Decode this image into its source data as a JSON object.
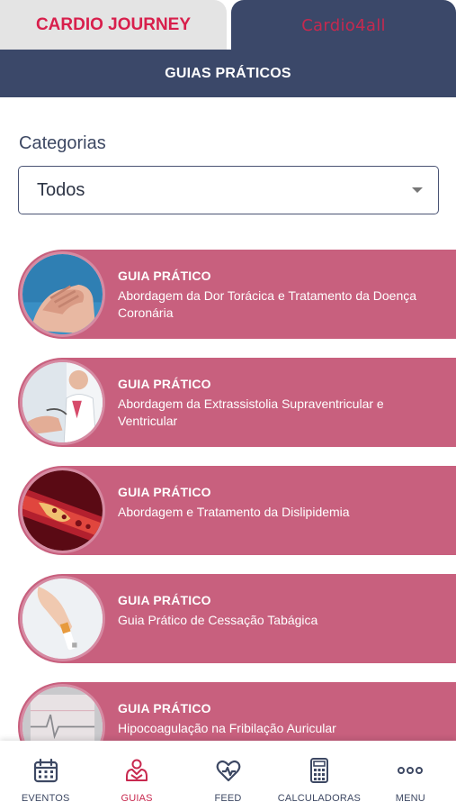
{
  "top_tabs": {
    "left": "CARDIO JOURNEY",
    "right": "Cardio4all"
  },
  "header": {
    "title": "GUIAS PRÁTICOS"
  },
  "categories": {
    "label": "Categorias",
    "selected": "Todos"
  },
  "guides": [
    {
      "kicker": "GUIA PRÁTICO",
      "title": "Abordagem da Dor Torácica e Tratamento da Doença Coronária",
      "image": "chest-pain-photo"
    },
    {
      "kicker": "GUIA PRÁTICO",
      "title": "Abordagem da Extrassistolia Supraventricular e Ventricular",
      "image": "doctor-patient-photo"
    },
    {
      "kicker": "GUIA PRÁTICO",
      "title": "Abordagem e Tratamento da Dislipidemia",
      "image": "artery-plaque-photo"
    },
    {
      "kicker": "GUIA PRÁTICO",
      "title": "Guia Prático de Cessação Tabágica",
      "image": "cigarette-photo"
    },
    {
      "kicker": "GUIA PRÁTICO",
      "title": "Hipocoagulação na Fribilação Auricular",
      "image": "ecg-strip-photo"
    }
  ],
  "bottom_nav": [
    {
      "label": "EVENTOS",
      "icon": "calendar-icon",
      "active": false
    },
    {
      "label": "GUIAS",
      "icon": "guide-hands-icon",
      "active": true
    },
    {
      "label": "FEED",
      "icon": "heart-pulse-icon",
      "active": false
    },
    {
      "label": "CALCULADORAS",
      "icon": "calculator-icon",
      "active": false
    },
    {
      "label": "MENU",
      "icon": "more-dots-icon",
      "active": false
    }
  ],
  "colors": {
    "navy": "#3b4869",
    "guide_card": "#c8607e",
    "accent_red": "#d81f4c",
    "tab_inactive": "#e4e4e4"
  }
}
